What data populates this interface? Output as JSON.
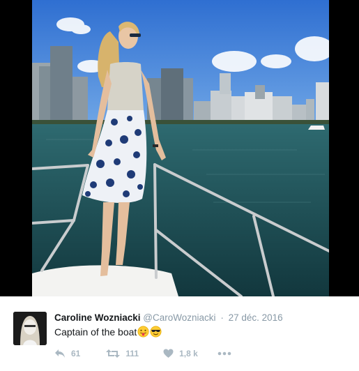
{
  "tweet": {
    "author_name": "Caroline Wozniacki",
    "handle": "@CaroWozniacki",
    "separator": "·",
    "date": "27 déc. 2016",
    "text": "Captain of the boat",
    "emojis": [
      "tongue-face-emoji",
      "sunglasses-face-emoji"
    ]
  },
  "actions": {
    "reply_count": "61",
    "retweet_count": "111",
    "like_count": "1,8 k"
  },
  "colors": {
    "name": "#14171a",
    "meta": "#8899a6",
    "action": "#aab8c2"
  }
}
